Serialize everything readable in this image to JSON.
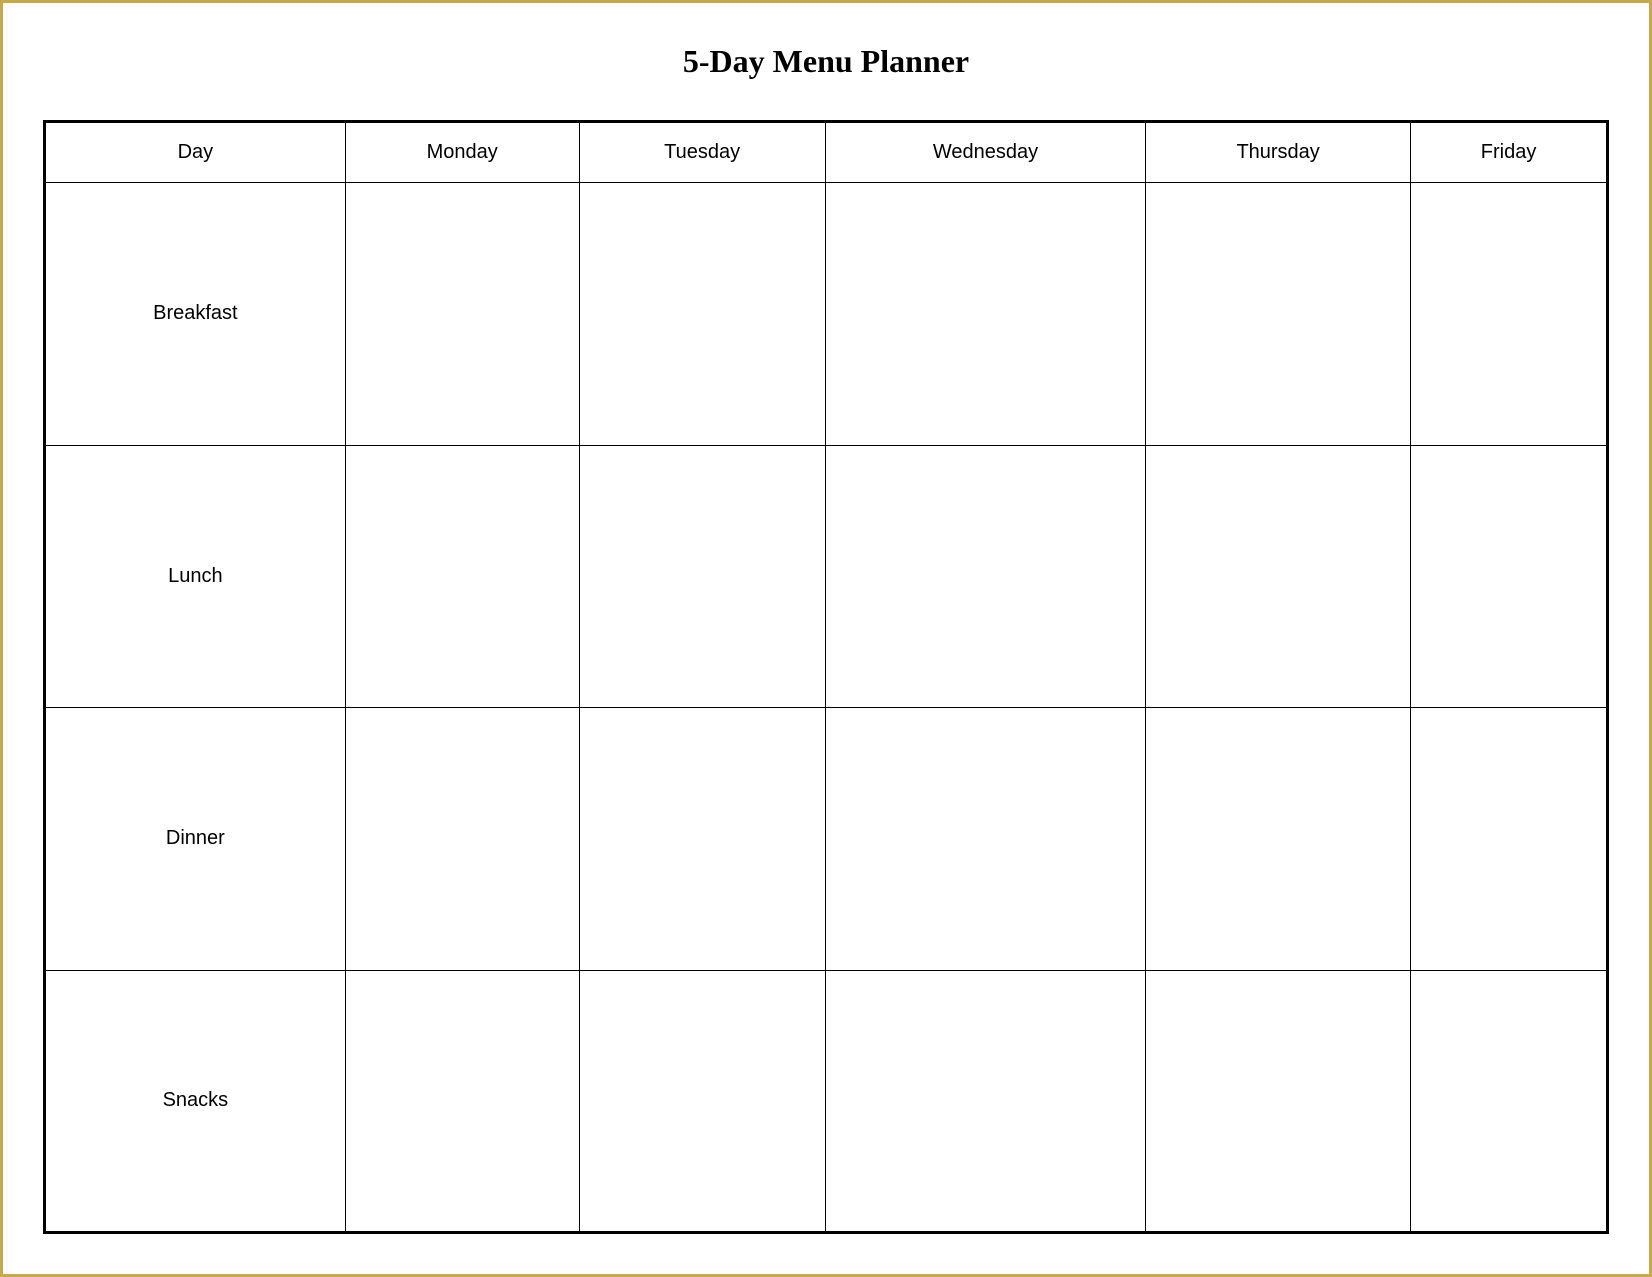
{
  "title": "5-Day Menu Planner",
  "table": {
    "headers": [
      "Day",
      "Monday",
      "Tuesday",
      "Wednesday",
      "Thursday",
      "Friday"
    ],
    "rows": [
      {
        "label": "Breakfast"
      },
      {
        "label": "Lunch"
      },
      {
        "label": "Dinner"
      },
      {
        "label": "Snacks"
      }
    ]
  }
}
